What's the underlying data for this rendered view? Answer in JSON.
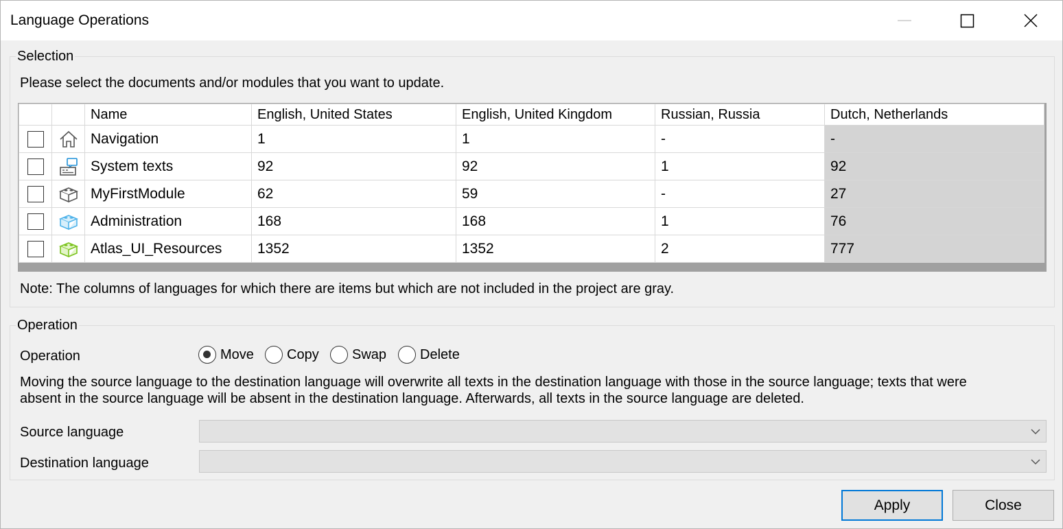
{
  "window": {
    "title": "Language Operations"
  },
  "selection": {
    "group_label": "Selection",
    "instruction": "Please select the documents and/or modules that you want to update.",
    "columns": [
      "Name",
      "English, United States",
      "English, United Kingdom",
      "Russian, Russia",
      "Dutch, Netherlands"
    ],
    "rows": [
      {
        "icon": "home-icon",
        "name": "Navigation",
        "en_us": "1",
        "en_gb": "1",
        "ru_ru": "-",
        "nl_nl": "-",
        "checked": false
      },
      {
        "icon": "system-texts-icon",
        "name": "System texts",
        "en_us": "92",
        "en_gb": "92",
        "ru_ru": "1",
        "nl_nl": "92",
        "checked": false
      },
      {
        "icon": "module-gray-icon",
        "name": "MyFirstModule",
        "en_us": "62",
        "en_gb": "59",
        "ru_ru": "-",
        "nl_nl": "27",
        "checked": false
      },
      {
        "icon": "module-blue-icon",
        "name": "Administration",
        "en_us": "168",
        "en_gb": "168",
        "ru_ru": "1",
        "nl_nl": "76",
        "checked": false
      },
      {
        "icon": "module-green-icon",
        "name": "Atlas_UI_Resources",
        "en_us": "1352",
        "en_gb": "1352",
        "ru_ru": "2",
        "nl_nl": "777",
        "checked": false
      }
    ],
    "note": "Note: The columns of languages for which there are items but which are not included in the project are gray."
  },
  "operation": {
    "group_label": "Operation",
    "label": "Operation",
    "options": [
      "Move",
      "Copy",
      "Swap",
      "Delete"
    ],
    "selected": "Move",
    "description_line1": "Moving the source language to the destination language will overwrite all texts in the destination language with those in the source language; texts that were",
    "description_line2": "absent in the source language will be absent in the destination language. Afterwards, all texts in the source language are deleted.",
    "source_label": "Source language",
    "source_value": "",
    "destination_label": "Destination language",
    "destination_value": ""
  },
  "buttons": {
    "apply": "Apply",
    "close": "Close"
  },
  "colors": {
    "gray_column": "#d4d4d4",
    "default_button_border": "#0078d7",
    "system_icon": "#1e90d8",
    "admin_icon": "#4fb3ea",
    "atlas_icon": "#7ac21c"
  }
}
